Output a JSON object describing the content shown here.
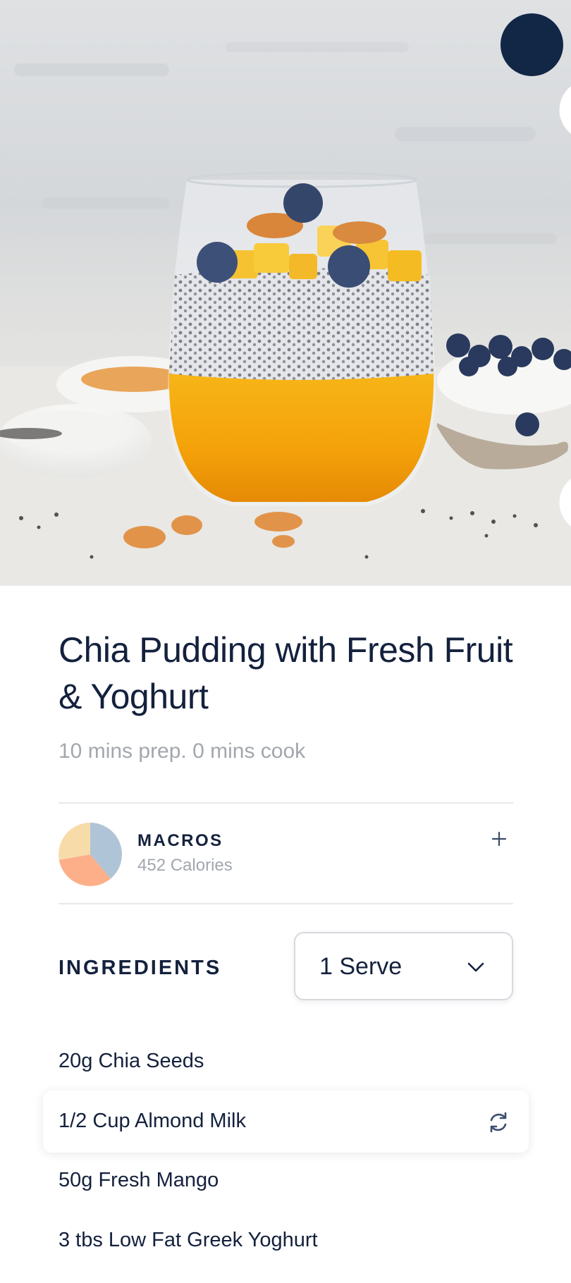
{
  "recipe": {
    "title": "Chia Pudding with Fresh Fruit & Yoghurt",
    "time": "10 mins prep. 0 mins cook"
  },
  "header": {
    "close_icon": "close-icon"
  },
  "macros": {
    "label": "MACROS",
    "calories": "452 Calories",
    "expand_icon": "plus-icon",
    "chart_colors": [
      "#b0c4d7",
      "#fcaf89",
      "#f7dcaa"
    ]
  },
  "ingredients": {
    "heading": "INGREDIENTS",
    "serving_select": "1 Serve",
    "items": [
      "20g Chia Seeds",
      "1/2 Cup Almond Milk",
      "50g Fresh Mango",
      "3 tbs Low Fat Greek Yoghurt"
    ],
    "swap_icon": "swap-icon"
  }
}
